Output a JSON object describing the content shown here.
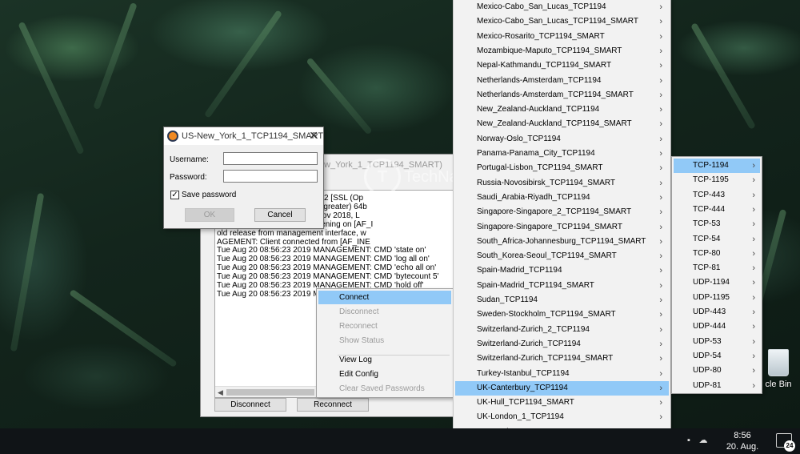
{
  "desktop": {
    "recycle_bin_label": "cle Bin"
  },
  "taskbar": {
    "time": "8:56",
    "date": "20. Aug. 2019",
    "notification_count": "24"
  },
  "login_dialog": {
    "title": "US-New_York_1_TCP1194_SMART",
    "username_label": "Username:",
    "password_label": "Password:",
    "username_value": "",
    "password_value": "",
    "save_password_label": "Save password",
    "save_password_checked": true,
    "ok_label": "OK",
    "cancel_label": "Cancel"
  },
  "log_window": {
    "title": "ew_York_1_TCP1194_SMART)",
    "lines": [
      "                                   PN 2.4.7 x86_64-w64-mingw32 [SSL (Op",
      "                                   ws version 6.2 (Windows 8 or greater) 64b",
      "                                   ersions: OpenSSL 1.1.0j  20 Nov 2018, L",
      "                                   MAGEMENT: TCP Socket listening on [AF_I",
      "                                   old release from management interface, w",
      "                                   AGEMENT: Client connected from [AF_INE",
      "Tue Aug 20 08:56:23 2019 MANAGEMENT: CMD 'state on'",
      "Tue Aug 20 08:56:23 2019 MANAGEMENT: CMD 'log all on'",
      "Tue Aug 20 08:56:23 2019 MANAGEMENT: CMD 'echo all on'",
      "Tue Aug 20 08:56:23 2019 MANAGEMENT: CMD 'bytecount 5'",
      "Tue Aug 20 08:56:23 2019 MANAGEMENT: CMD 'hold off'",
      "Tue Aug 20 08:56:23 2019 MANAG"
    ],
    "disconnect_label": "Disconnect",
    "reconnect_label": "Reconnect"
  },
  "watermark": {
    "logo_letter": "T",
    "text": "TechNadu"
  },
  "context_menu": {
    "items": [
      {
        "label": "Connect",
        "enabled": true
      },
      {
        "label": "Disconnect",
        "enabled": false
      },
      {
        "label": "Reconnect",
        "enabled": false
      },
      {
        "label": "Show Status",
        "enabled": false
      },
      {
        "label": "View Log",
        "enabled": true
      },
      {
        "label": "Edit Config",
        "enabled": true
      },
      {
        "label": "Clear Saved Passwords",
        "enabled": false
      }
    ]
  },
  "server_menu": {
    "items": [
      "Mexico-Cabo_San_Lucas_TCP1194",
      "Mexico-Cabo_San_Lucas_TCP1194_SMART",
      "Mexico-Rosarito_TCP1194_SMART",
      "Mozambique-Maputo_TCP1194_SMART",
      "Nepal-Kathmandu_TCP1194_SMART",
      "Netherlands-Amsterdam_TCP1194",
      "Netherlands-Amsterdam_TCP1194_SMART",
      "New_Zealand-Auckland_TCP1194",
      "New_Zealand-Auckland_TCP1194_SMART",
      "Norway-Oslo_TCP1194",
      "Panama-Panama_City_TCP1194",
      "Portugal-Lisbon_TCP1194_SMART",
      "Russia-Novosibirsk_TCP1194_SMART",
      "Saudi_Arabia-Riyadh_TCP1194",
      "Singapore-Singapore_2_TCP1194_SMART",
      "Singapore-Singapore_TCP1194_SMART",
      "South_Africa-Johannesburg_TCP1194_SMART",
      "South_Korea-Seoul_TCP1194_SMART",
      "Spain-Madrid_TCP1194",
      "Spain-Madrid_TCP1194_SMART",
      "Sudan_TCP1194",
      "Sweden-Stockholm_TCP1194_SMART",
      "Switzerland-Zurich_2_TCP1194",
      "Switzerland-Zurich_TCP1194",
      "Switzerland-Zurich_TCP1194_SMART",
      "Turkey-Istanbul_TCP1194",
      "UK-Canterbury_TCP1194",
      "UK-Hull_TCP1194_SMART",
      "UK-London_1_TCP1194",
      "UK-London_1_TCP1194_SMART"
    ],
    "highlighted": "UK-Canterbury_TCP1194",
    "scroll_arrow": "▼"
  },
  "protocol_menu": {
    "items": [
      "TCP-1194",
      "TCP-1195",
      "TCP-443",
      "TCP-444",
      "TCP-53",
      "TCP-54",
      "TCP-80",
      "TCP-81",
      "UDP-1194",
      "UDP-1195",
      "UDP-443",
      "UDP-444",
      "UDP-53",
      "UDP-54",
      "UDP-80",
      "UDP-81"
    ],
    "highlighted": "TCP-1194"
  },
  "colors": {
    "menu_highlight": "#91c9f7",
    "menu_background": "#f2f2f2",
    "disabled_text": "#9a9a9a",
    "taskbar": "#101417"
  }
}
